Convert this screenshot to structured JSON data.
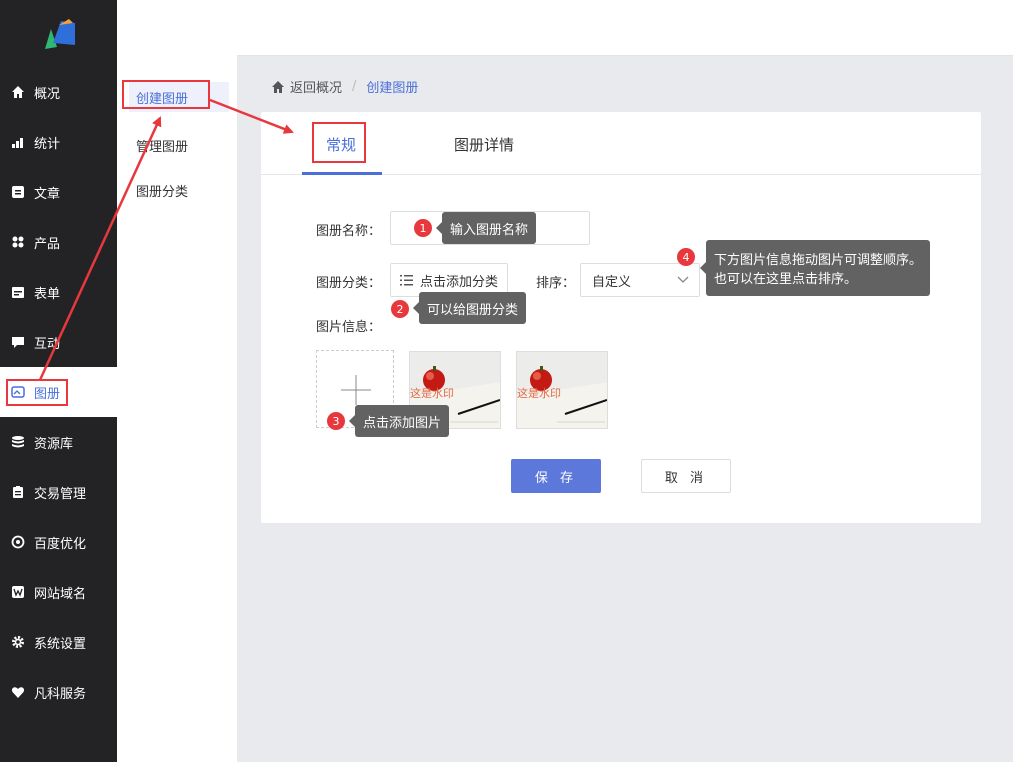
{
  "sidebar": {
    "items": [
      {
        "label": "概况",
        "icon": "home-icon"
      },
      {
        "label": "统计",
        "icon": "chart-icon"
      },
      {
        "label": "文章",
        "icon": "article-icon"
      },
      {
        "label": "产品",
        "icon": "grid-icon"
      },
      {
        "label": "表单",
        "icon": "calendar-icon"
      },
      {
        "label": "互动",
        "icon": "chat-icon"
      },
      {
        "label": "图册",
        "icon": "album-icon"
      },
      {
        "label": "资源库",
        "icon": "database-icon"
      },
      {
        "label": "交易管理",
        "icon": "clipboard-icon"
      },
      {
        "label": "百度优化",
        "icon": "target-icon"
      },
      {
        "label": "网站域名",
        "icon": "w-icon"
      },
      {
        "label": "系统设置",
        "icon": "gear-icon"
      },
      {
        "label": "凡科服务",
        "icon": "heart-icon"
      }
    ]
  },
  "subnav": {
    "items": [
      "创建图册",
      "管理图册",
      "图册分类"
    ]
  },
  "breadcrumb": {
    "back": "返回概况",
    "sep": "/",
    "current": "创建图册"
  },
  "tabs": {
    "general": "常规",
    "details": "图册详情"
  },
  "form": {
    "name_label": "图册名称：",
    "category_label": "图册分类：",
    "category_button": "点击添加分类",
    "sort_label": "排序：",
    "sort_value": "自定义",
    "images_label": "图片信息：",
    "watermark": "这是水印",
    "save": "保 存",
    "cancel": "取 消"
  },
  "tips": [
    {
      "num": "1",
      "text": "输入图册名称"
    },
    {
      "num": "2",
      "text": "可以给图册分类"
    },
    {
      "num": "3",
      "text": "点击添加图片"
    },
    {
      "num": "4",
      "line1": "下方图片信息拖动图片可调整顺序。",
      "line2": "也可以在这里点击排序。"
    }
  ],
  "colors": {
    "accent": "#4a6fd8",
    "highlight": "#e8383d",
    "sidebar_bg": "#232325"
  }
}
